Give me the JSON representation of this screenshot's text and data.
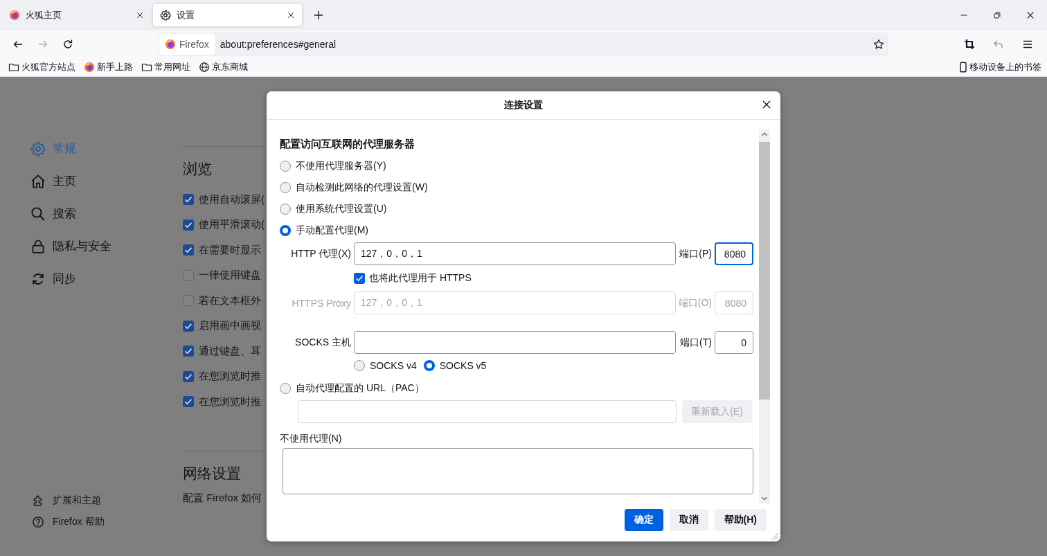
{
  "tabs": [
    {
      "title": "火狐主页",
      "selected": false
    },
    {
      "title": "设置",
      "selected": true
    }
  ],
  "url_bar": {
    "identity": "Firefox",
    "url": "about:preferences#general"
  },
  "bookmarks": [
    {
      "label": "火狐官方站点"
    },
    {
      "label": "新手上路"
    },
    {
      "label": "常用网址"
    },
    {
      "label": "京东商城"
    }
  ],
  "mobile_bookmarks": "移动设备上的书签",
  "sidebar": {
    "items": [
      {
        "label": "常规",
        "selected": true
      },
      {
        "label": "主页",
        "selected": false
      },
      {
        "label": "搜索",
        "selected": false
      },
      {
        "label": "隐私与安全",
        "selected": false
      },
      {
        "label": "同步",
        "selected": false
      }
    ],
    "footer": [
      {
        "label": "扩展和主题"
      },
      {
        "label": "Firefox 帮助"
      }
    ]
  },
  "browsing": {
    "heading": "浏览",
    "options": [
      {
        "label": "使用自动滚屏(",
        "checked": true
      },
      {
        "label": "使用平滑滚动(",
        "checked": true
      },
      {
        "label": "在需要时显示",
        "checked": true
      },
      {
        "label": "一律使用键盘",
        "checked": false
      },
      {
        "label": "若在文本框外",
        "checked": false
      },
      {
        "label": "启用画中画视",
        "checked": true
      },
      {
        "label": "通过键盘、耳",
        "checked": true
      },
      {
        "label": "在您浏览时推",
        "checked": true
      },
      {
        "label": "在您浏览时推",
        "checked": true
      }
    ]
  },
  "network": {
    "heading": "网络设置",
    "description": "配置 Firefox 如何"
  },
  "dialog": {
    "title": "连接设置",
    "heading": "配置访问互联网的代理服务器",
    "proxy_modes": [
      {
        "label": "不使用代理服务器(Y)",
        "selected": false
      },
      {
        "label": "自动检测此网络的代理设置(W)",
        "selected": false
      },
      {
        "label": "使用系统代理设置(U)",
        "selected": false
      },
      {
        "label": "手动配置代理(M)",
        "selected": true
      }
    ],
    "http_proxy": {
      "label": "HTTP 代理(X)",
      "value": "127，0，0，1",
      "port_label": "端口(P)",
      "port": "8080",
      "disabled": false,
      "port_focused": true
    },
    "also_https": {
      "label": "也将此代理用于 HTTPS",
      "checked": true
    },
    "https_proxy": {
      "label": "HTTPS Proxy",
      "value": "127，0，0，1",
      "port_label": "端口(O)",
      "port": "8080",
      "disabled": true,
      "port_focused": false
    },
    "socks": {
      "label": "SOCKS 主机",
      "port_label": "端口(T)",
      "port": "0",
      "disabled": false,
      "port_focused": false
    },
    "socks_versions": [
      {
        "label": "SOCKS v4",
        "selected": false
      },
      {
        "label": "SOCKS v5",
        "selected": true
      }
    ],
    "pac": {
      "label": "自动代理配置的 URL（PAC）",
      "selected": false,
      "reload_button": "重新载入(E)",
      "reload_disabled": true
    },
    "no_proxy_label": "不使用代理(N)",
    "buttons": [
      {
        "label": "确定",
        "kind": "primary"
      },
      {
        "label": "取消",
        "kind": "secondary"
      },
      {
        "label": "帮助(H)",
        "kind": "secondary"
      }
    ]
  }
}
